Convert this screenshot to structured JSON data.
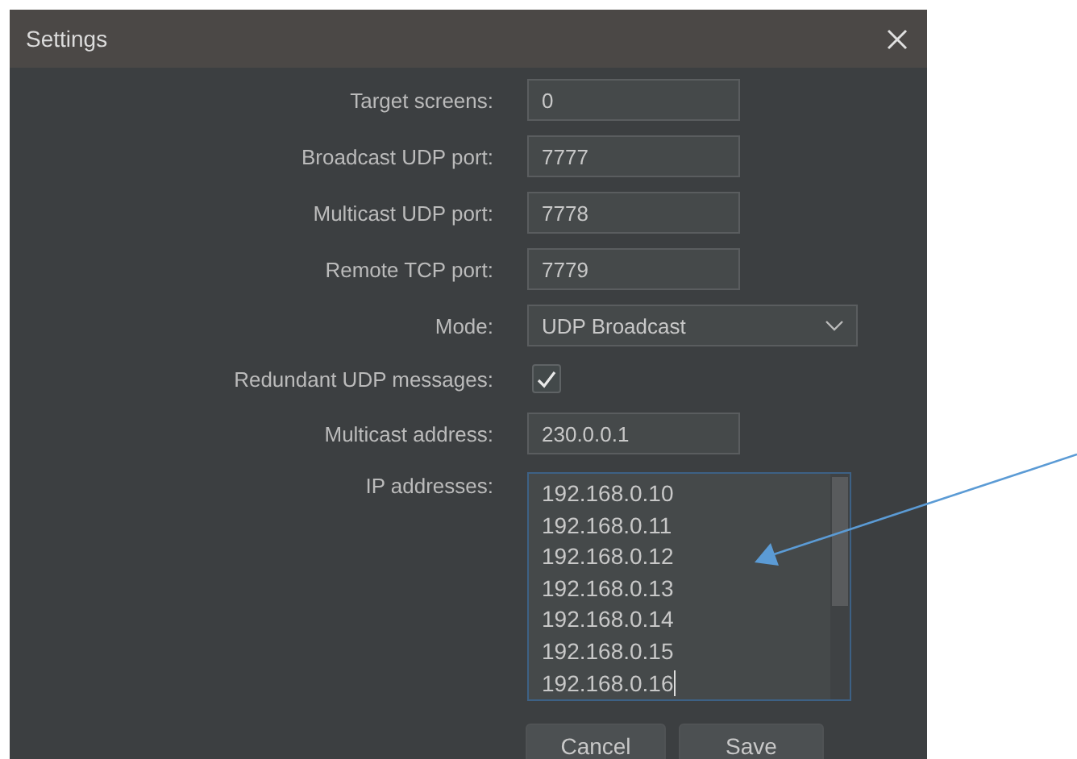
{
  "window": {
    "title": "Settings"
  },
  "fields": [
    {
      "kind": "text",
      "label": "Target screens:",
      "value": "0"
    },
    {
      "kind": "text",
      "label": "Broadcast UDP port:",
      "value": "7777"
    },
    {
      "kind": "text",
      "label": "Multicast UDP port:",
      "value": "7778"
    },
    {
      "kind": "text",
      "label": "Remote TCP port:",
      "value": "7779"
    },
    {
      "kind": "dropdown",
      "label": "Mode:",
      "value": "UDP Broadcast"
    },
    {
      "kind": "checkbox",
      "label": "Redundant UDP messages:",
      "checked": true
    },
    {
      "kind": "text",
      "label": "Multicast address:",
      "value": "230.0.0.1"
    },
    {
      "kind": "list",
      "label": "IP addresses:",
      "lines": [
        "192.168.0.10",
        "192.168.0.11",
        "192.168.0.12",
        "192.168.0.13",
        "192.168.0.14",
        "192.168.0.15",
        "192.168.0.16"
      ]
    }
  ],
  "buttons": [
    "Cancel",
    "Save"
  ]
}
